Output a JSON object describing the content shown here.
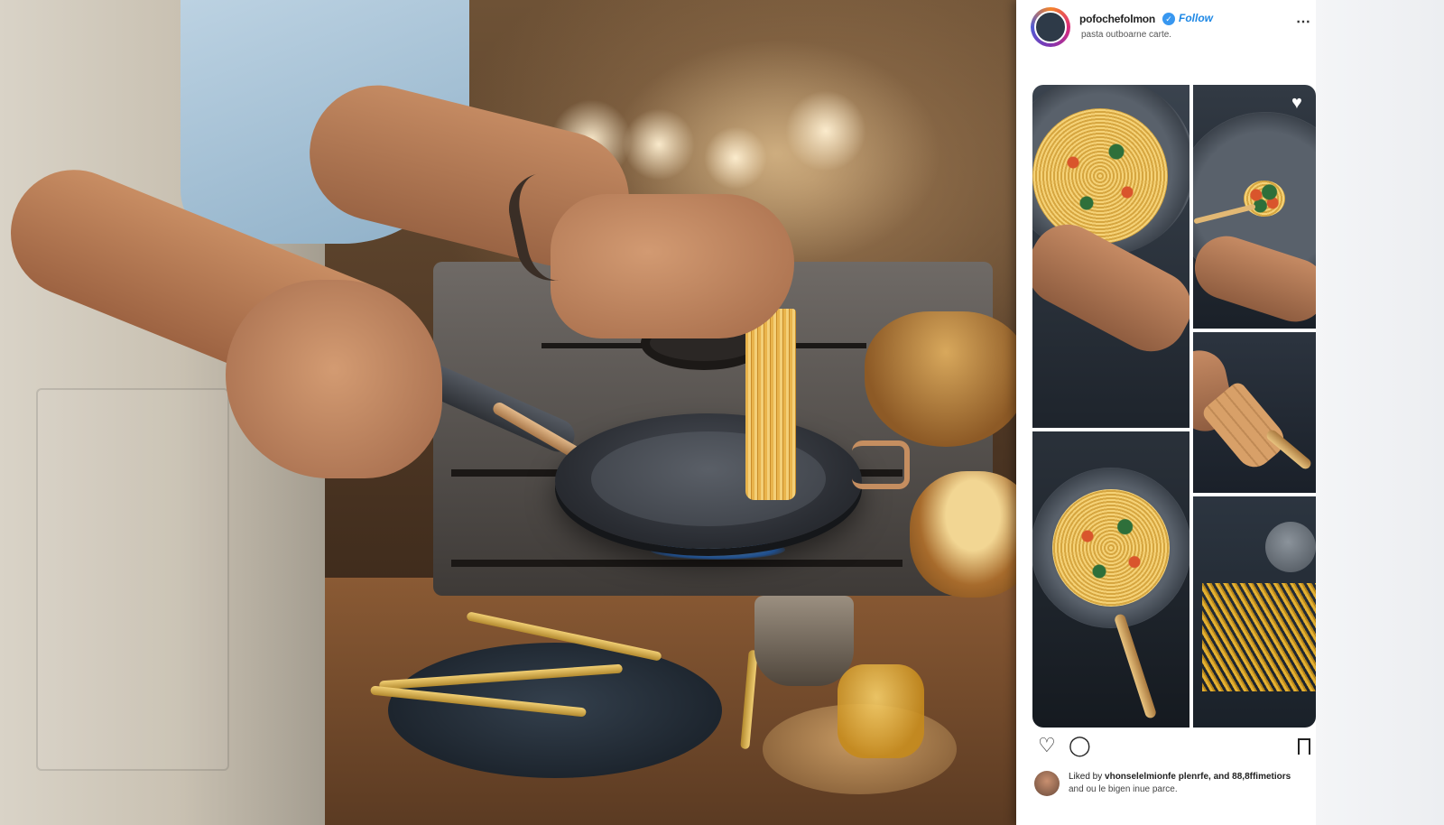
{
  "post": {
    "username": "pofochefolmon",
    "verified_badge": "✓",
    "follow_label": "Follow",
    "location": "pasta outboarne carte.",
    "more_icon": "⋯"
  },
  "grid": {
    "like_icon": "♥"
  },
  "actions": {
    "heart_icon": "♡",
    "comment_icon": "◯"
  },
  "liked_by": {
    "line1_prefix": "Liked by",
    "line1_names": "vhonselelmionfe plenrfe, and",
    "line1_count": "88,8ffimetiors",
    "line2": "and ou le bigen inue parce."
  }
}
